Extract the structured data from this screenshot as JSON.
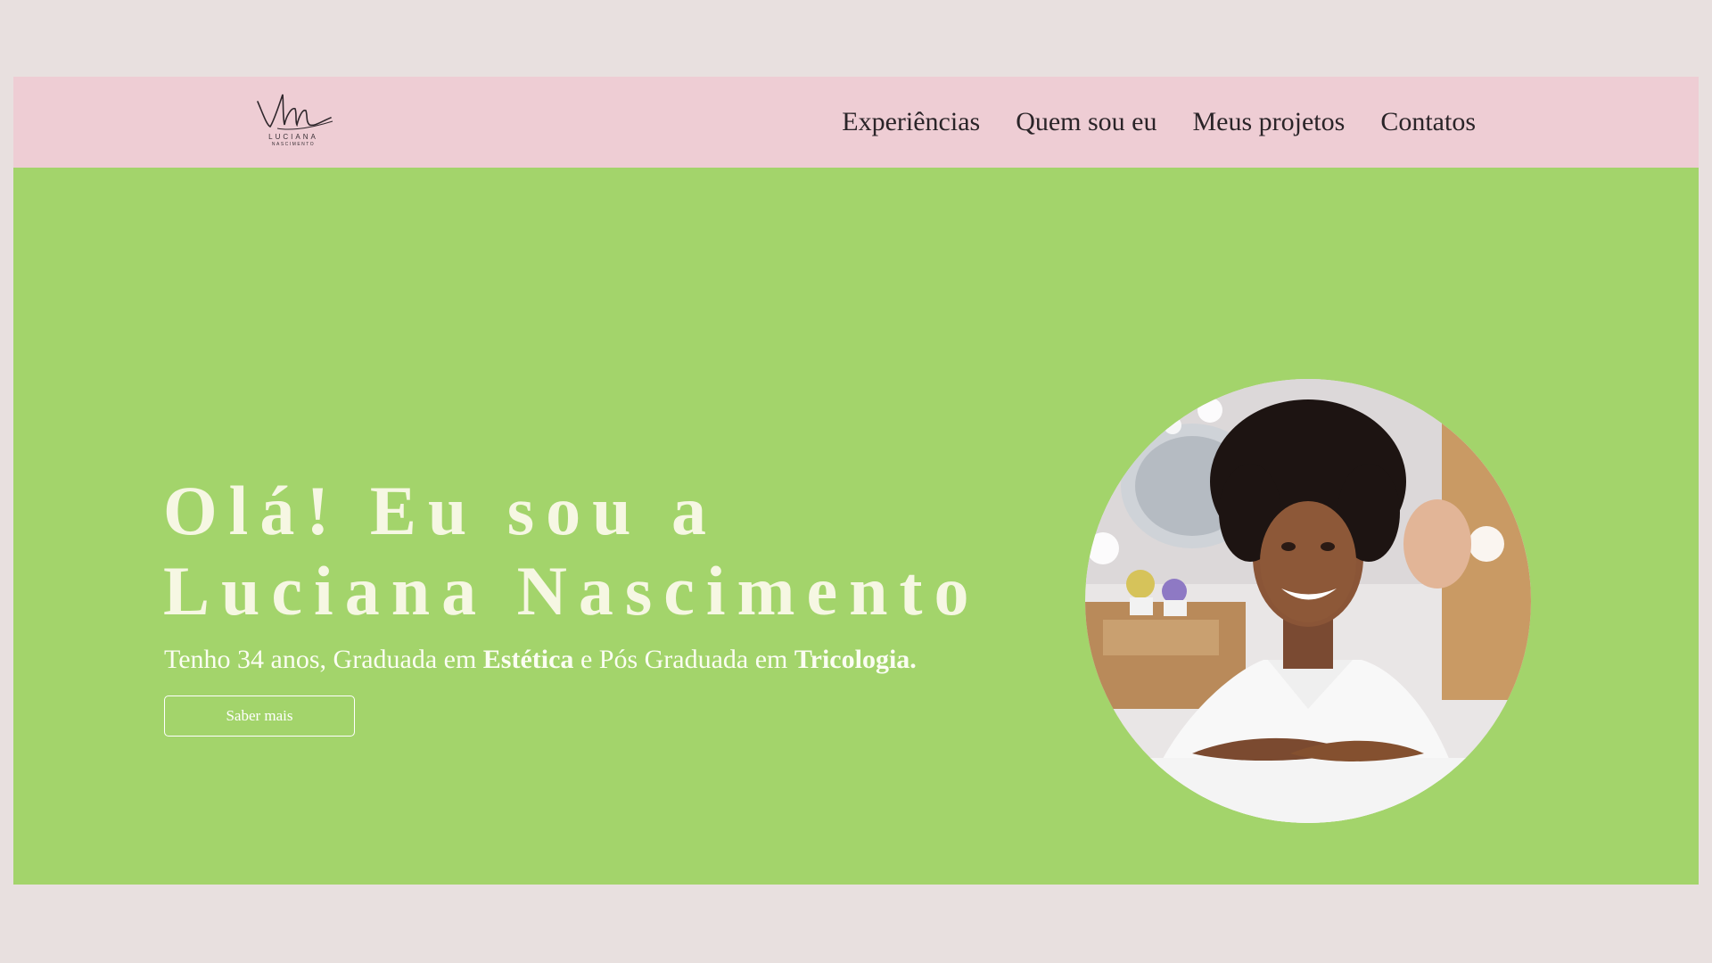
{
  "header": {
    "logo": {
      "name": "LUCIANA",
      "subtitle": "NASCIMENTO",
      "mark_icon": "signature-monogram-icon"
    },
    "nav": [
      {
        "label": "Experiências"
      },
      {
        "label": "Quem sou eu"
      },
      {
        "label": "Meus projetos"
      },
      {
        "label": "Contatos"
      }
    ]
  },
  "hero": {
    "title_line1": "Olá! Eu sou a",
    "title_line2": "Luciana Nascimento",
    "subtitle": {
      "part1": "Tenho 34 anos, Graduada em ",
      "bold1": "Estética",
      "part2": " e Pós Graduada em ",
      "bold2": "Tricologia."
    },
    "button_label": "Saber mais",
    "photo_icon": "portrait-photo"
  },
  "colors": {
    "page_background": "#e8e0df",
    "header_background": "#eecdd4",
    "hero_background": "#a3d46b",
    "hero_text": "#f6f7e3",
    "nav_text": "#2a2428"
  }
}
